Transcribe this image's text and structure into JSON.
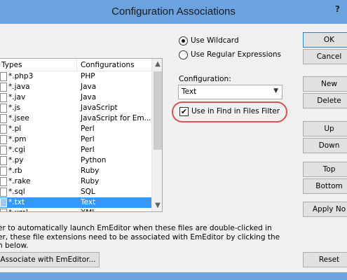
{
  "window": {
    "title": "Configuration Associations",
    "help_label": "?"
  },
  "list": {
    "columns": [
      "Types",
      "Configurations"
    ],
    "rows": [
      {
        "ext": "*.php3",
        "config": "PHP"
      },
      {
        "ext": "*.java",
        "config": "Java"
      },
      {
        "ext": "*.jav",
        "config": "Java"
      },
      {
        "ext": "*.js",
        "config": "JavaScript"
      },
      {
        "ext": "*.jsee",
        "config": "JavaScript for Em..."
      },
      {
        "ext": "*.pl",
        "config": "Perl"
      },
      {
        "ext": "*.pm",
        "config": "Perl"
      },
      {
        "ext": "*.cgi",
        "config": "Perl"
      },
      {
        "ext": "*.py",
        "config": "Python"
      },
      {
        "ext": "*.rb",
        "config": "Ruby"
      },
      {
        "ext": "*.rake",
        "config": "Ruby"
      },
      {
        "ext": "*.sql",
        "config": "SQL"
      },
      {
        "ext": "*.txt",
        "config": "Text"
      },
      {
        "ext": "*.xml",
        "config": "XML"
      }
    ],
    "selected_ext": "*.txt"
  },
  "options": {
    "use_wildcard": "Use Wildcard",
    "use_regex": "Use Regular Expressions",
    "selected": "wildcard",
    "configuration_label": "Configuration:",
    "configuration_value": "Text",
    "find_filter_label": "Use in Find in Files Filter",
    "find_filter_checked": true,
    "check_mark": "✔"
  },
  "buttons": {
    "ok": "OK",
    "cancel": "Cancel",
    "new": "New",
    "delete": "Delete",
    "up": "Up",
    "down": "Down",
    "top": "Top",
    "bottom": "Bottom",
    "apply_now": "Apply No",
    "associate": "Associate with EmEditor...",
    "reset": "Reset"
  },
  "description": [
    "er to automatically launch EmEditor when these files are double-clicked in",
    "er, these file extensions need to be associated with EmEditor by clicking the",
    "n below."
  ],
  "colors": {
    "title_bar": "#6aa3e0",
    "selection": "#3399ff",
    "highlight_ring": "#d9534f"
  }
}
